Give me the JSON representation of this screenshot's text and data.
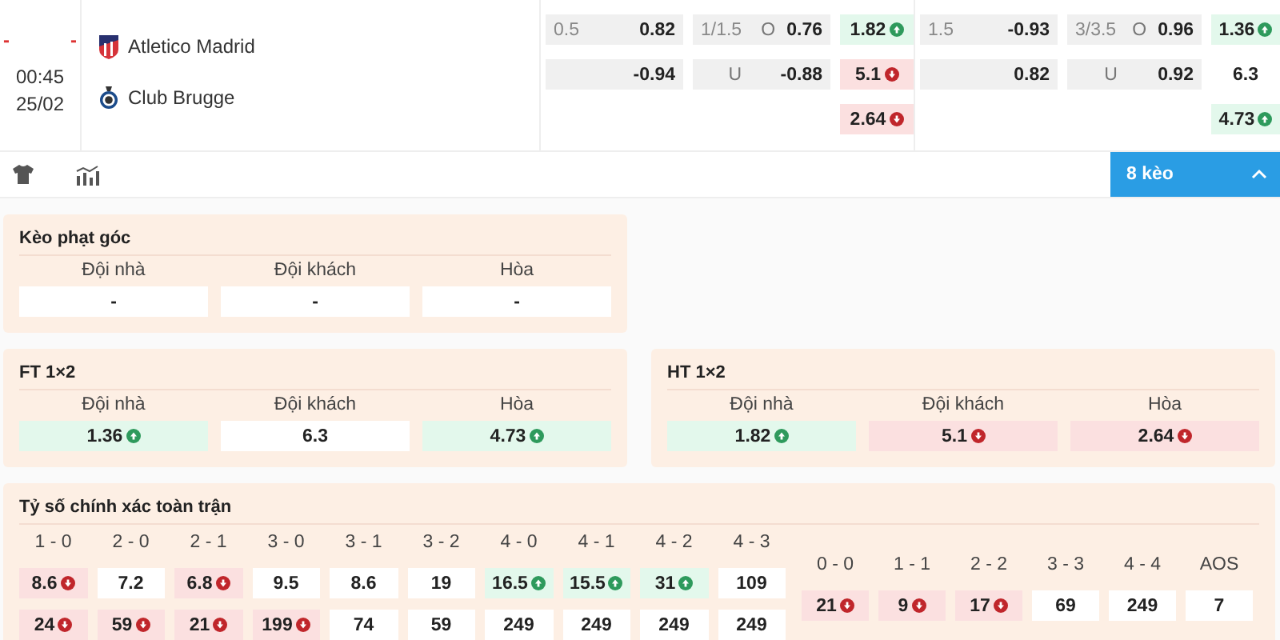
{
  "match": {
    "score_home": "-",
    "score_away": "-",
    "time": "00:45",
    "date": "25/02",
    "home": {
      "name": "Atletico Madrid"
    },
    "away": {
      "name": "Club Brugge"
    }
  },
  "odds_groups": [
    {
      "handicap": [
        {
          "line": "0.5",
          "odds": "0.82"
        },
        {
          "odds": "-0.94"
        }
      ],
      "over_under": [
        {
          "line": "1/1.5",
          "side": "O",
          "odds": "0.76"
        },
        {
          "side": "U",
          "odds": "-0.88"
        }
      ],
      "one_x_two": [
        {
          "value": "1.82",
          "kind": "up"
        },
        {
          "value": "5.1",
          "kind": "down"
        },
        {
          "value": "2.64",
          "kind": "down"
        }
      ]
    },
    {
      "handicap": [
        {
          "line": "1.5",
          "odds": "-0.93"
        },
        {
          "odds": "0.82"
        }
      ],
      "over_under": [
        {
          "line": "3/3.5",
          "side": "O",
          "odds": "0.96"
        },
        {
          "side": "U",
          "odds": "0.92"
        }
      ],
      "one_x_two": [
        {
          "value": "1.36",
          "kind": "up"
        },
        {
          "value": "6.3",
          "kind": "plain"
        },
        {
          "value": "4.73",
          "kind": "up"
        }
      ]
    }
  ],
  "more_markets": {
    "label": "8 kèo",
    "expanded": true
  },
  "panels": [
    {
      "title": "Kèo phạt góc",
      "columns": [
        {
          "label": "Đội nhà",
          "cell": {
            "value": "-",
            "kind": "plain"
          }
        },
        {
          "label": "Đội khách",
          "cell": {
            "value": "-",
            "kind": "plain"
          }
        },
        {
          "label": "Hòa",
          "cell": {
            "value": "-",
            "kind": "plain"
          }
        }
      ]
    },
    {
      "title": "FT 1×2",
      "columns": [
        {
          "label": "Đội nhà",
          "cell": {
            "value": "1.36",
            "kind": "up"
          }
        },
        {
          "label": "Đội khách",
          "cell": {
            "value": "6.3",
            "kind": "plain"
          }
        },
        {
          "label": "Hòa",
          "cell": {
            "value": "4.73",
            "kind": "up"
          }
        }
      ]
    },
    {
      "title": "HT 1×2",
      "columns": [
        {
          "label": "Đội nhà",
          "cell": {
            "value": "1.82",
            "kind": "up"
          }
        },
        {
          "label": "Đội khách",
          "cell": {
            "value": "5.1",
            "kind": "down"
          }
        },
        {
          "label": "Hòa",
          "cell": {
            "value": "2.64",
            "kind": "down"
          }
        }
      ]
    }
  ],
  "correct_score": {
    "title": "Tỷ số chính xác toàn trận",
    "scores": [
      {
        "label": "1 - 0",
        "odds": [
          {
            "value": "8.6",
            "kind": "down"
          },
          {
            "value": "24",
            "kind": "down"
          }
        ]
      },
      {
        "label": "2 - 0",
        "odds": [
          {
            "value": "7.2",
            "kind": "plain"
          },
          {
            "value": "59",
            "kind": "down"
          }
        ]
      },
      {
        "label": "2 - 1",
        "odds": [
          {
            "value": "6.8",
            "kind": "down"
          },
          {
            "value": "21",
            "kind": "down"
          }
        ]
      },
      {
        "label": "3 - 0",
        "odds": [
          {
            "value": "9.5",
            "kind": "plain"
          },
          {
            "value": "199",
            "kind": "down"
          }
        ]
      },
      {
        "label": "3 - 1",
        "odds": [
          {
            "value": "8.6",
            "kind": "plain"
          },
          {
            "value": "74",
            "kind": "plain"
          }
        ]
      },
      {
        "label": "3 - 2",
        "odds": [
          {
            "value": "19",
            "kind": "plain"
          },
          {
            "value": "59",
            "kind": "plain"
          }
        ]
      },
      {
        "label": "4 - 0",
        "odds": [
          {
            "value": "16.5",
            "kind": "up"
          },
          {
            "value": "249",
            "kind": "plain"
          }
        ]
      },
      {
        "label": "4 - 1",
        "odds": [
          {
            "value": "15.5",
            "kind": "up"
          },
          {
            "value": "249",
            "kind": "plain"
          }
        ]
      },
      {
        "label": "4 - 2",
        "odds": [
          {
            "value": "31",
            "kind": "up"
          },
          {
            "value": "249",
            "kind": "plain"
          }
        ]
      },
      {
        "label": "4 - 3",
        "odds": [
          {
            "value": "109",
            "kind": "plain"
          },
          {
            "value": "249",
            "kind": "plain"
          }
        ]
      }
    ],
    "draws": [
      {
        "label": "0 - 0",
        "odds": [
          {
            "value": "21",
            "kind": "down"
          }
        ]
      },
      {
        "label": "1 - 1",
        "odds": [
          {
            "value": "9",
            "kind": "down"
          }
        ]
      },
      {
        "label": "2 - 2",
        "odds": [
          {
            "value": "17",
            "kind": "down"
          }
        ]
      },
      {
        "label": "3 - 3",
        "odds": [
          {
            "value": "69",
            "kind": "plain"
          }
        ]
      },
      {
        "label": "4 - 4",
        "odds": [
          {
            "value": "249",
            "kind": "plain"
          }
        ]
      },
      {
        "label": "AOS",
        "odds": [
          {
            "value": "7",
            "kind": "plain"
          }
        ]
      }
    ]
  }
}
